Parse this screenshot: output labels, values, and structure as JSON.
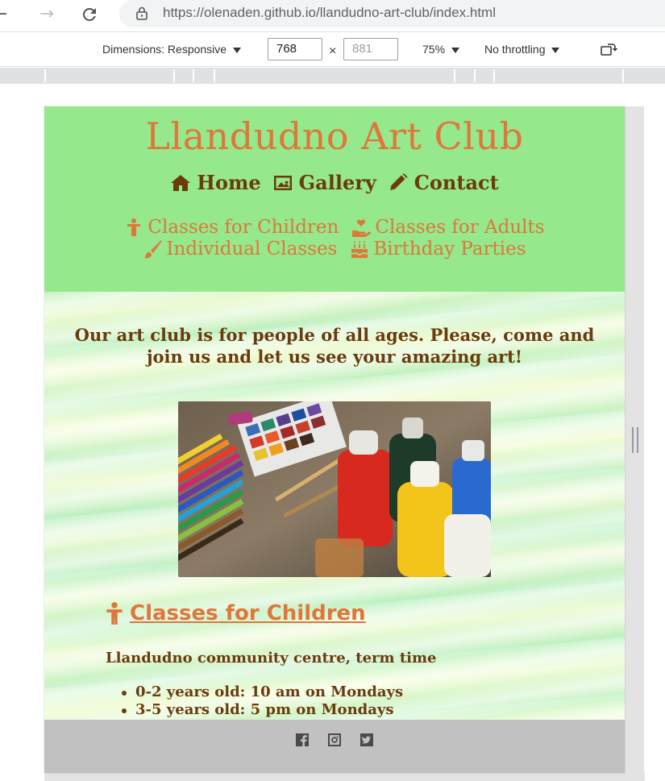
{
  "browser": {
    "url": "https://olenaden.github.io/llandudno-art-club/index.html"
  },
  "devtools": {
    "dimensions_label": "Dimensions: Responsive",
    "width": "768",
    "height_placeholder": "881",
    "times": "×",
    "zoom": "75%",
    "throttling": "No throttling"
  },
  "site": {
    "title": "Llandudno Art Club",
    "main_nav": [
      {
        "label": "Home",
        "icon": "home-icon"
      },
      {
        "label": "Gallery",
        "icon": "image-icon"
      },
      {
        "label": "Contact",
        "icon": "pencil-icon"
      }
    ],
    "class_nav": [
      {
        "label": "Classes for Children",
        "icon": "child-icon"
      },
      {
        "label": "Classes for Adults",
        "icon": "hand-holding-heart-icon"
      },
      {
        "label": "Individual Classes",
        "icon": "paintbrush-icon"
      },
      {
        "label": "Birthday Parties",
        "icon": "birthday-cake-icon"
      }
    ],
    "intro": "Our art club is for people of all ages. Please, come and join us and let us see your amazing art!",
    "section": {
      "heading": " Classes  for  Children",
      "location": "Llandudno community centre, term time",
      "schedule": [
        "0-2 years old: 10 am on Mondays",
        "3-5 years old: 5 pm on Mondays"
      ]
    },
    "footer_icons": [
      "facebook-icon",
      "instagram-icon",
      "twitter-icon"
    ],
    "colors": {
      "header_bg": "#95e88c",
      "accent_orange": "#e0763a",
      "text_brown": "#6b3b0e",
      "footer_bg": "#c1c1c1"
    }
  }
}
